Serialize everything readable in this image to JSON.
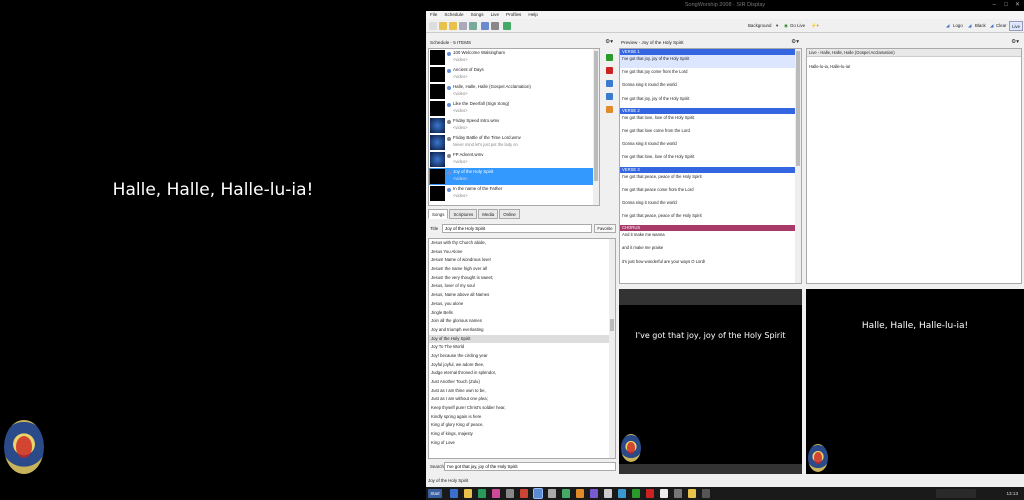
{
  "projector": {
    "lyric": "Halle, Halle, Halle-lu-ia!"
  },
  "window": {
    "title": "SongWorship 2008 · SIR Display"
  },
  "menu": [
    "File",
    "Schedule",
    "Songs",
    "Live",
    "Profiles",
    "Help"
  ],
  "toolbar": {
    "background_label": "Background",
    "golive_label": "Go Live",
    "logo_label": "Logo",
    "black_label": "Black",
    "clear_label": "Clear",
    "live_label": "Live"
  },
  "schedule": {
    "header": "Schedule - 5 ITEMS",
    "items": [
      {
        "title": "100 Welcome Walsingham",
        "sub": "<video>",
        "thumb": "dark"
      },
      {
        "title": "Ancient of Days",
        "sub": "<video>",
        "thumb": "dark"
      },
      {
        "title": "Halle, Halle, Halle (Gospel Acclamation)",
        "sub": "<video>",
        "thumb": "dark"
      },
      {
        "title": "Like the Deerfall (Sign Song)",
        "sub": "<video>",
        "thumb": "dark"
      },
      {
        "title": "Friday Speed Intro.wmv",
        "sub": "<video>",
        "thumb": "blue"
      },
      {
        "title": "Friday Battle of the Time Lord.wmv",
        "sub": "Never mind let's just put the lady on",
        "thumb": "blue"
      },
      {
        "title": "FP Advent.wmv",
        "sub": "<video>",
        "thumb": "blue"
      },
      {
        "title": "Joy of the Holy Spirit",
        "sub": "<video>",
        "thumb": "dark",
        "selected": true
      },
      {
        "title": "In the name of the Father",
        "sub": "<video>",
        "thumb": "dark"
      }
    ]
  },
  "tabs": [
    "Songs",
    "Scriptures",
    "Media",
    "Online"
  ],
  "song_search": {
    "label": "Title",
    "value": "Joy of the Holy Spirit",
    "favorite_label": "Favorite"
  },
  "songs": [
    "Jesus with thy Church abide,",
    "Jesus You Alone",
    "Jesus! Name of wondrous love!",
    "Jesus! the name high over all",
    "Jesus! the very thought is sweet;",
    "Jesus, lover of my soul",
    "Jesus, Name above all Names",
    "Jesus, you alone",
    "Jingle Bells",
    "Join all the glorious names",
    "Joy and triumph everlasting",
    "Joy of the Holy Spirit",
    "Joy To The World",
    "Joy! because the circling year",
    "Joyful joyful, we adore thee,",
    "Judge eternal throned in splendor,",
    "Just Another Touch (Zulu)",
    "Just as I am thine own to be,",
    "Just as I am without one plea;",
    "Keep thyself pure! Christ's soldier hear,",
    "Kindly spring again is here",
    "King of glory King of peace,",
    "King of kings, majesty",
    "King of Love"
  ],
  "selected_song": "Joy of the Holy Spirit",
  "bottom_search": {
    "label": "Search",
    "value": "I've got that joy, joy of the Holy Spirit"
  },
  "preview": {
    "header": "Preview - Joy of the Holy Spirit",
    "sections": [
      {
        "tag": "VERSE 1",
        "type": "verse",
        "lines": [
          "I've got that joy, joy of the Holy Spirit",
          "I've got that joy come from the Lord",
          "Gonna sing it round the world",
          "I've got that joy, joy of the Holy Spirit"
        ]
      },
      {
        "tag": "VERSE 2",
        "type": "verse",
        "lines": [
          "I've got that love, love of the Holy Spirit",
          "I've got that love come from the Lord",
          "Gonna sing it round the world",
          "I've got that love, love of the Holy Spirit"
        ]
      },
      {
        "tag": "VERSE 3",
        "type": "verse",
        "lines": [
          "I've got that peace, peace of the Holy Spirit",
          "I've got that peace come from the Lord",
          "Gonna sing it round the world",
          "I've got that peace, peace of the Holy Spirit"
        ]
      },
      {
        "tag": "CHORUS",
        "type": "chorus",
        "lines": [
          "And it make me wanna",
          "and it make me praise",
          "it's just how wonderful are your ways O Lord!"
        ]
      }
    ]
  },
  "live": {
    "header": "Live - Halle, Halle, Halle (Gospel Acclamation)",
    "line": "Halle-lu-ia, Halle-lu-ia!"
  },
  "monitor_preview": {
    "text": "I've got that joy, joy of the Holy Spirit"
  },
  "monitor_live": {
    "text": "Halle, Halle, Halle-lu-ia!"
  },
  "status": "Joy of the Holy Spirit",
  "taskbar": {
    "start_label": "Start",
    "clock": "13:13"
  }
}
